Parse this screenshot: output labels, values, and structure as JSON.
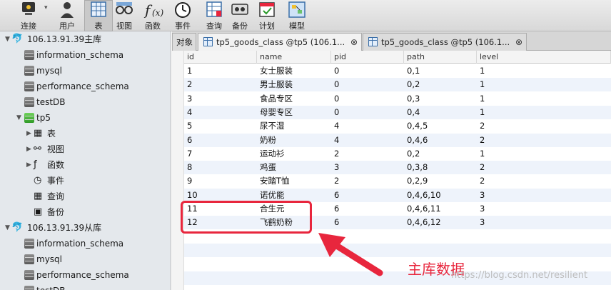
{
  "toolbar": {
    "items": [
      {
        "label": "连接",
        "icon": "connection-icon"
      },
      {
        "label": "用户",
        "icon": "user-icon"
      },
      {
        "label": "表",
        "icon": "table-icon",
        "active": true
      },
      {
        "label": "视图",
        "icon": "view-icon"
      },
      {
        "label": "函数",
        "icon": "function-icon"
      },
      {
        "label": "事件",
        "icon": "event-clock-icon"
      },
      {
        "label": "查询",
        "icon": "query-icon"
      },
      {
        "label": "备份",
        "icon": "backup-icon"
      },
      {
        "label": "计划",
        "icon": "schedule-icon"
      },
      {
        "label": "模型",
        "icon": "model-icon"
      }
    ]
  },
  "sidebar": {
    "master_conn": "106.13.91.39主库",
    "master_dbs": [
      "information_schema",
      "mysql",
      "performance_schema",
      "testDB"
    ],
    "tp5": "tp5",
    "tp5_children": [
      "表",
      "视图",
      "函数",
      "事件",
      "查询",
      "备份"
    ],
    "slave_conn": "106.13.91.39从库",
    "slave_dbs": [
      "information_schema",
      "mysql",
      "performance_schema",
      "testDB"
    ]
  },
  "tabs": {
    "objects": "对象",
    "tab1": "tp5_goods_class @tp5 (106.1...",
    "tab2": "tp5_goods_class @tp5 (106.1..."
  },
  "grid": {
    "columns": [
      "id",
      "name",
      "pid",
      "path",
      "level"
    ],
    "rows": [
      [
        "1",
        "女士服装",
        "0",
        "0,1",
        "1"
      ],
      [
        "2",
        "男士服装",
        "0",
        "0,2",
        "1"
      ],
      [
        "3",
        "食品专区",
        "0",
        "0,3",
        "1"
      ],
      [
        "4",
        "母婴专区",
        "0",
        "0,4",
        "1"
      ],
      [
        "5",
        "尿不湿",
        "4",
        "0,4,5",
        "2"
      ],
      [
        "6",
        "奶粉",
        "4",
        "0,4,6",
        "2"
      ],
      [
        "7",
        "运动衫",
        "2",
        "0,2",
        "1"
      ],
      [
        "8",
        "鸡蛋",
        "3",
        "0,3,8",
        "2"
      ],
      [
        "9",
        "安踏T恤",
        "2",
        "0,2,9",
        "2"
      ],
      [
        "10",
        "诺优能",
        "6",
        "0,4,6,10",
        "3"
      ],
      [
        "11",
        "合生元",
        "6",
        "0,4,6,11",
        "3"
      ],
      [
        "12",
        "飞鹤奶粉",
        "6",
        "0,4,6,12",
        "3"
      ]
    ]
  },
  "annotation": {
    "label": "主库数据",
    "color": "#e8263d"
  },
  "watermark": "https://blog.csdn.net/resilient"
}
